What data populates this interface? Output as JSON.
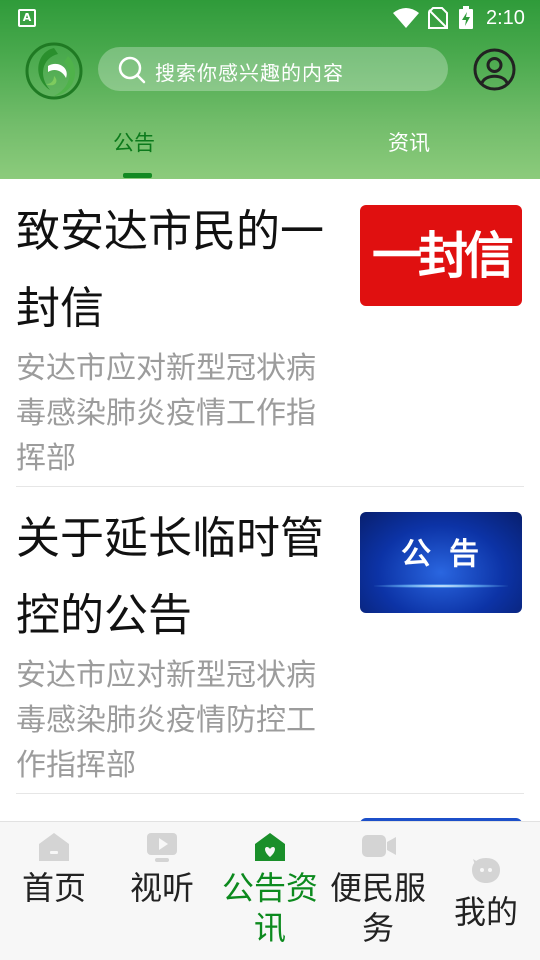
{
  "status_bar": {
    "time": "2:10",
    "app_indicator": "A",
    "icons": [
      "wifi-icon",
      "no-sim-icon",
      "battery-charging-icon"
    ]
  },
  "header": {
    "logo_icon": "app-logo",
    "search_placeholder": "搜索你感兴趣的内容",
    "account_icon": "user-circle-icon",
    "tabs": [
      {
        "label": "公告",
        "active": true
      },
      {
        "label": "资讯",
        "active": false
      }
    ]
  },
  "articles": [
    {
      "title": "致安达市民的一封信",
      "summary": "安达市应对新型冠状病毒感染肺炎疫情工作指挥部",
      "thumb_text": "一封信"
    },
    {
      "title": "关于延长临时管控的公告",
      "summary": "安达市应对新型冠状病毒感染肺炎疫情防控工作指挥部",
      "thumb_text": "公告"
    }
  ],
  "bottom_nav": [
    {
      "label": "首页",
      "icon": "home-icon",
      "active": false
    },
    {
      "label": "视听",
      "icon": "video-play-icon",
      "active": false
    },
    {
      "label": "公告资讯",
      "icon": "home-heart-icon",
      "active": true
    },
    {
      "label": "便民服务",
      "icon": "camera-icon",
      "active": false
    },
    {
      "label": "我的",
      "icon": "chat-face-icon",
      "active": false
    }
  ],
  "colors": {
    "brand_green": "#2f9b3a",
    "active_tab": "#0c7a1c",
    "summary_gray": "#9c9c9c",
    "nav_active": "#0c8a1e"
  }
}
